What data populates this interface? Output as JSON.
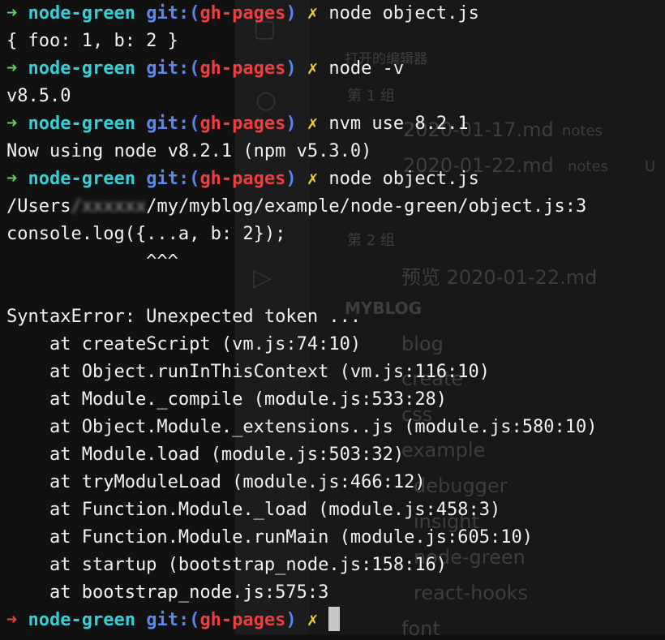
{
  "background_editor": {
    "open_editors_title": "打开的编辑器",
    "group1": "第 1 组",
    "file1_name": "2020-01-17.md",
    "file1_folder": "notes",
    "file2_name": "2020-01-22.md",
    "file2_folder": "notes",
    "file2_badge": "U",
    "group2": "第 2 组",
    "preview_label": "预览 2020-01-22.md",
    "workspace_title": "MYBLOG",
    "tree": [
      "blog",
      "create",
      "css",
      "example",
      "debugger",
      "insight",
      "node-green",
      "react-hooks",
      "font"
    ]
  },
  "terminal": {
    "prompt": {
      "arrow": "➜",
      "dir": "node-green",
      "git_prefix": "git:(",
      "branch": "gh-pages",
      "git_suffix": ")",
      "dirty": "✗"
    },
    "lines": [
      {
        "kind": "prompt",
        "command": "node object.js"
      },
      {
        "kind": "output",
        "text": "{ foo: 1, b: 2 }"
      },
      {
        "kind": "prompt",
        "command": "node -v"
      },
      {
        "kind": "output",
        "text": "v8.5.0"
      },
      {
        "kind": "prompt",
        "command": "nvm use 8.2.1"
      },
      {
        "kind": "output",
        "text": "Now using node v8.2.1 (npm v5.3.0)"
      },
      {
        "kind": "prompt",
        "command": "node object.js"
      },
      {
        "kind": "path",
        "before": "/Users",
        "redacted": "/xxxxxx",
        "after": "/my/myblog/example/node-green/object.js:3"
      },
      {
        "kind": "output",
        "text": "console.log({...a, b: 2});"
      },
      {
        "kind": "output",
        "text": "             ^^^"
      },
      {
        "kind": "output",
        "text": ""
      },
      {
        "kind": "output",
        "text": "SyntaxError: Unexpected token ..."
      },
      {
        "kind": "output",
        "text": "    at createScript (vm.js:74:10)"
      },
      {
        "kind": "output",
        "text": "    at Object.runInThisContext (vm.js:116:10)"
      },
      {
        "kind": "output",
        "text": "    at Module._compile (module.js:533:28)"
      },
      {
        "kind": "output",
        "text": "    at Object.Module._extensions..js (module.js:580:10)"
      },
      {
        "kind": "output",
        "text": "    at Module.load (module.js:503:32)"
      },
      {
        "kind": "output",
        "text": "    at tryModuleLoad (module.js:466:12)"
      },
      {
        "kind": "output",
        "text": "    at Function.Module._load (module.js:458:3)"
      },
      {
        "kind": "output",
        "text": "    at Function.Module.runMain (module.js:605:10)"
      },
      {
        "kind": "output",
        "text": "    at startup (bootstrap_node.js:158:16)"
      },
      {
        "kind": "output",
        "text": "    at bootstrap_node.js:575:3"
      },
      {
        "kind": "prompt_error",
        "command": ""
      }
    ]
  },
  "colors": {
    "arrow_success": "#5fd35f",
    "arrow_error": "#f03d3d",
    "directory": "#35d0d7",
    "git_label": "#5c86f0",
    "branch": "#f03d3d",
    "dirty_marker": "#f0d23a"
  }
}
